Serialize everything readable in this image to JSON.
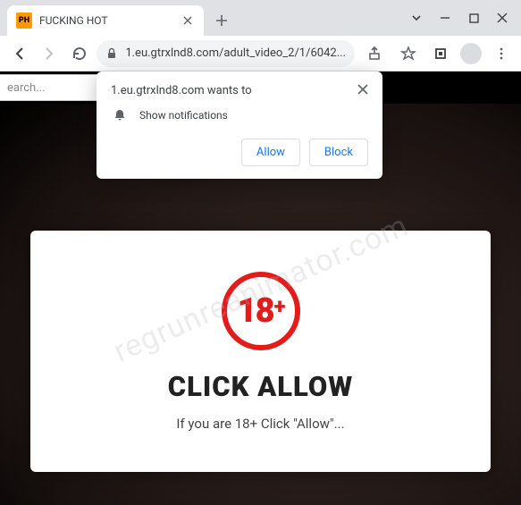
{
  "window": {
    "tab_title": "FUCKING HOT",
    "favicon_text": "PH"
  },
  "toolbar": {
    "url": "1.eu.gtrxlnd8.com/adult_video_2/1/6042..."
  },
  "page": {
    "search_placeholder": "earch..."
  },
  "card": {
    "age_number": "18",
    "age_plus": "+",
    "heading": "CLICK ALLOW",
    "subtitle": "If you are 18+ Click \"Allow\"..."
  },
  "notification": {
    "site_wants": "1.eu.gtrxlnd8.com wants to",
    "permission_label": "Show notifications",
    "allow": "Allow",
    "block": "Block"
  },
  "watermark": "regrunreanimator.com"
}
